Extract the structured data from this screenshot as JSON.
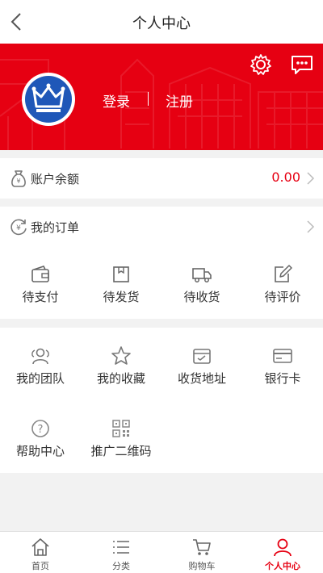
{
  "header": {
    "title": "个人中心",
    "back_icon": "chevron-left-icon"
  },
  "profile": {
    "avatar_icon": "crown-icon",
    "login_label": "登录",
    "separator": "|",
    "register_label": "注册",
    "settings_icon": "gear-icon",
    "message_icon": "chat-bubble-icon"
  },
  "balance": {
    "label": "账户余额",
    "value": "0.00",
    "icon": "money-bag-icon"
  },
  "orders": {
    "label": "我的订单",
    "icon": "yen-refresh-icon",
    "items": [
      {
        "label": "待支付",
        "icon": "wallet-icon"
      },
      {
        "label": "待发货",
        "icon": "box-icon"
      },
      {
        "label": "待收货",
        "icon": "truck-icon"
      },
      {
        "label": "待评价",
        "icon": "pencil-note-icon"
      }
    ]
  },
  "services": [
    {
      "label": "我的团队",
      "icon": "team-icon"
    },
    {
      "label": "我的收藏",
      "icon": "star-icon"
    },
    {
      "label": "收货地址",
      "icon": "address-box-icon"
    },
    {
      "label": "银行卡",
      "icon": "bank-card-icon"
    },
    {
      "label": "帮助中心",
      "icon": "help-icon"
    },
    {
      "label": "推广二维码",
      "icon": "qr-code-icon"
    }
  ],
  "tabbar": {
    "items": [
      {
        "label": "首页",
        "icon": "home-icon"
      },
      {
        "label": "分类",
        "icon": "list-icon"
      },
      {
        "label": "购物车",
        "icon": "cart-icon"
      },
      {
        "label": "个人中心",
        "icon": "user-icon"
      }
    ],
    "active_index": 3
  },
  "colors": {
    "brand_red": "#e60012",
    "avatar_blue": "#1f57b8",
    "icon_gray": "#777777"
  }
}
